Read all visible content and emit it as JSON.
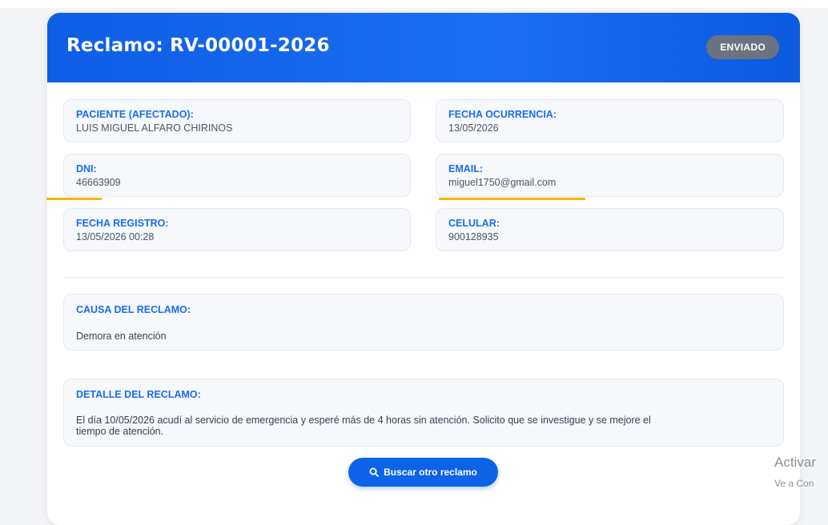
{
  "complaint": {
    "title": "Reclamo: RV-00001-2026",
    "status": "ENVIADO"
  },
  "fields": {
    "patient": {
      "label": "PACIENTE (AFECTADO):",
      "value": "LUIS MIGUEL ALFARO CHIRINOS"
    },
    "occurrence_date": {
      "label": "FECHA OCURRENCIA:",
      "value": "13/05/2026"
    },
    "dni": {
      "label": "DNI:",
      "value": "46663909"
    },
    "email": {
      "label": "EMAIL:",
      "value": "miguel1750@gmail.com"
    },
    "registration_date": {
      "label": "FECHA REGISTRO:",
      "value": "13/05/2026 00:28"
    },
    "phone": {
      "label": "CELULAR:",
      "value": "900128935"
    }
  },
  "cause": {
    "label": "CAUSA DEL RECLAMO:",
    "value": "Demora en atención"
  },
  "detail": {
    "label": "DETALLE DEL RECLAMO:",
    "value_line1": "El día 10/05/2026 acudí al servicio de emergencia y esperé más de 4 horas sin atención. Solicito que se investigue y se mejore el",
    "value_line2": "tiempo de atención."
  },
  "actions": {
    "search_again_label": "Buscar otro reclamo"
  },
  "watermark": {
    "line1": "Activar",
    "line2": "Ve a Con"
  },
  "colors": {
    "header_blue": "#1a6ff0",
    "label_blue": "#1a6cf0",
    "status_gray": "#6b7280",
    "highlight_yellow": "#f5b800"
  },
  "icons": {
    "search_button_icon": "search-icon"
  }
}
